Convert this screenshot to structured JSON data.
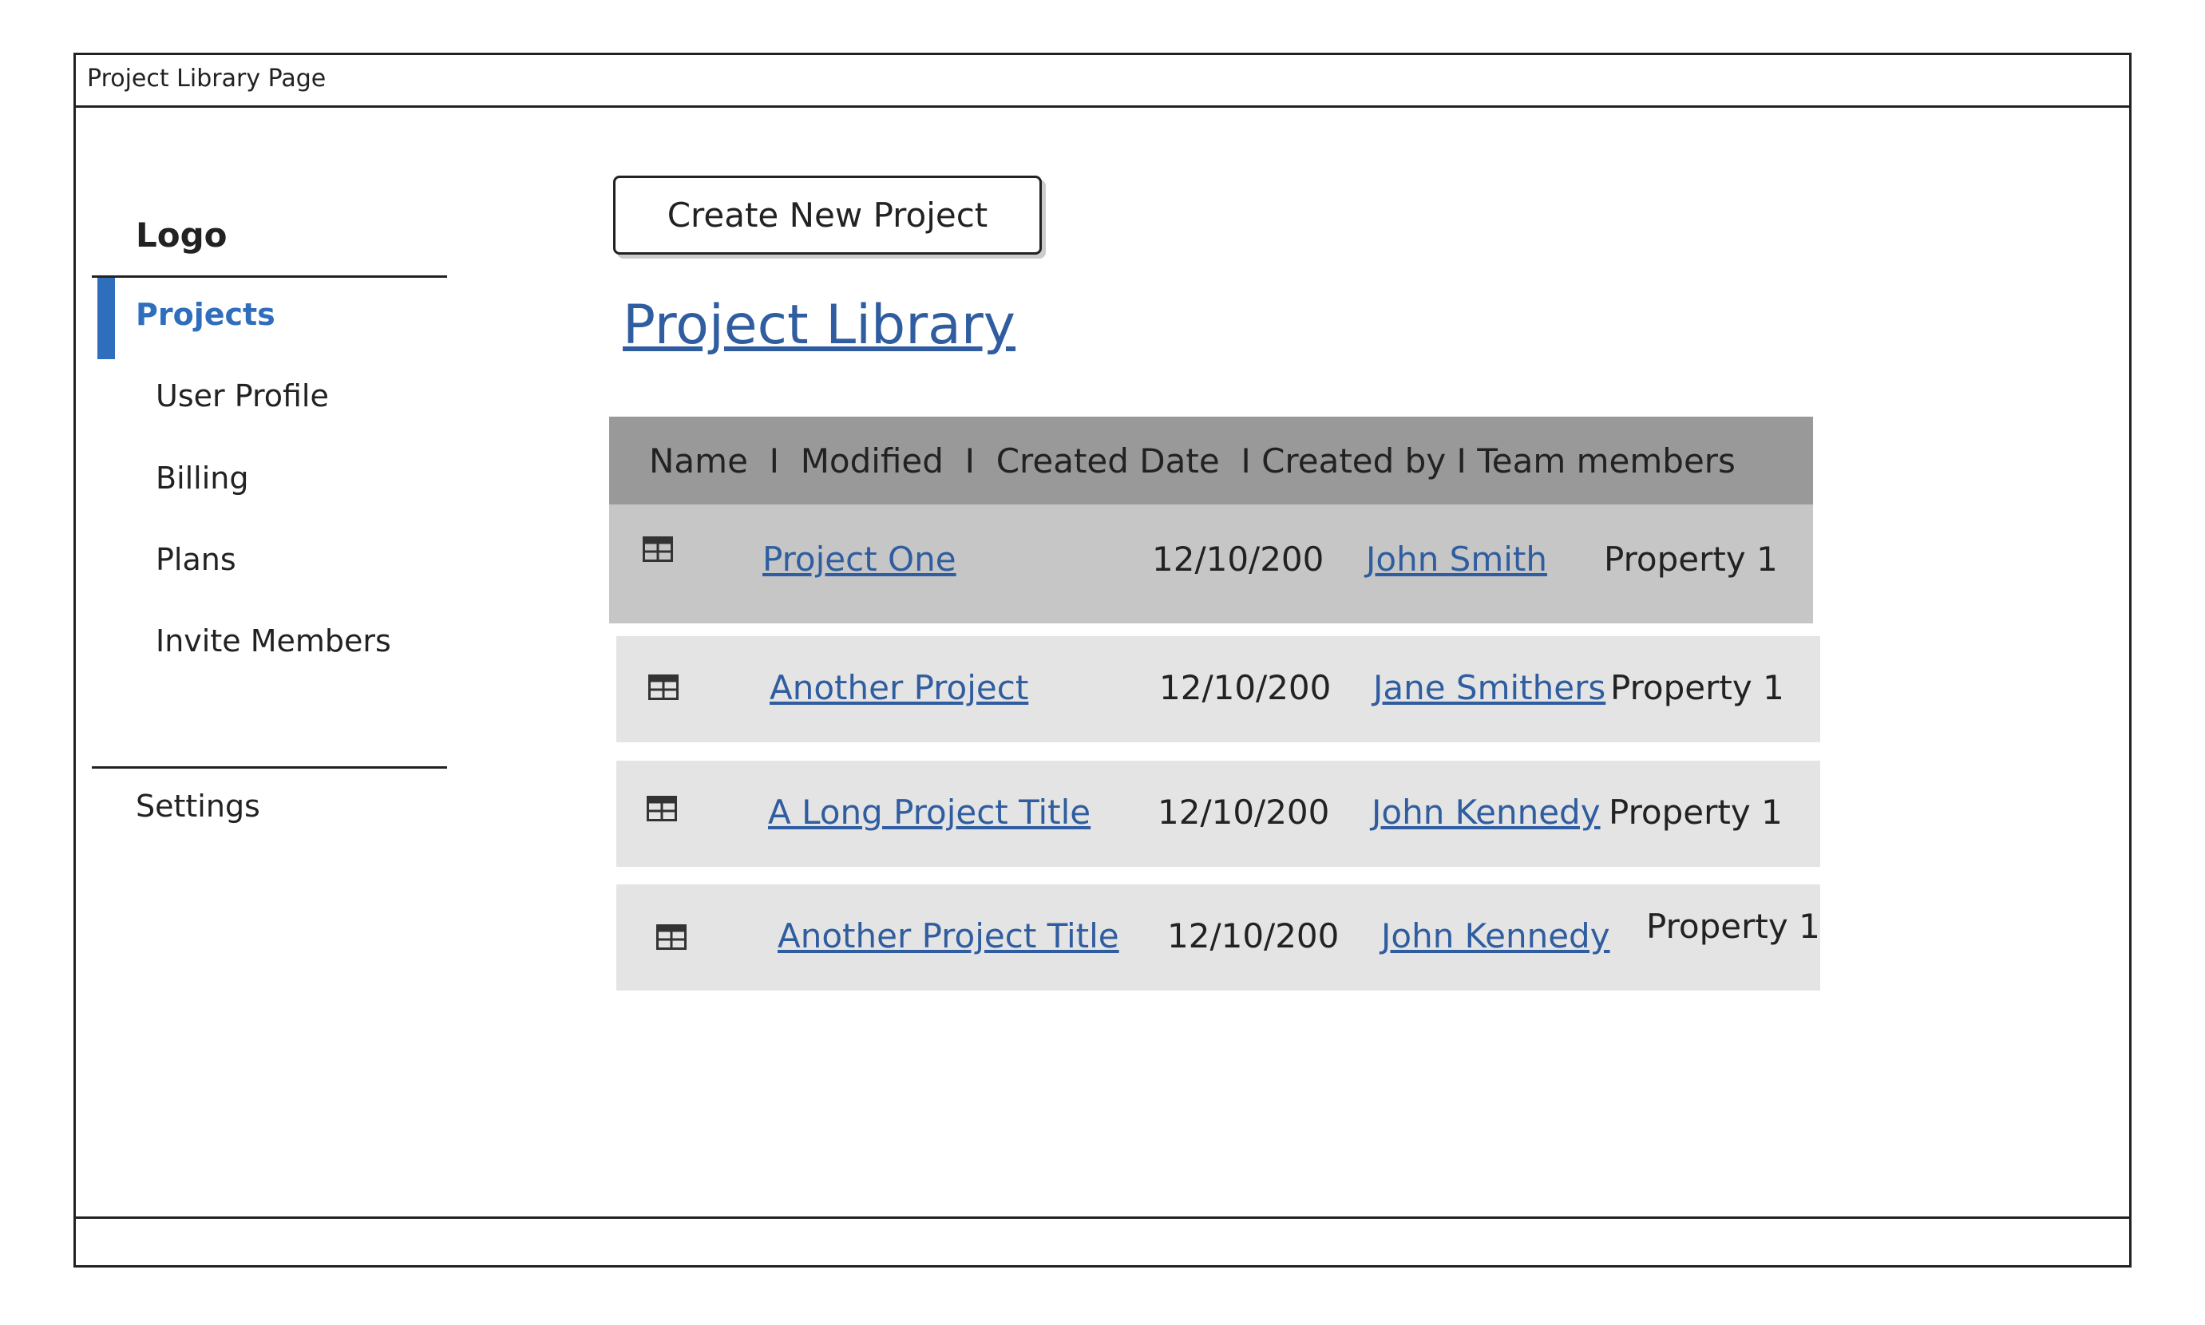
{
  "window": {
    "title": "Project Library Page"
  },
  "sidebar": {
    "logo": "Logo",
    "items": [
      {
        "label": "Projects",
        "active": true
      },
      {
        "label": "User Profile"
      },
      {
        "label": "Billing"
      },
      {
        "label": "Plans"
      },
      {
        "label": "Invite Members"
      }
    ],
    "settings_label": "Settings",
    "accent_color": "#2f6dbd"
  },
  "main": {
    "create_button_label": "Create New Project",
    "page_title": "Project Library",
    "table": {
      "header": "Name  I  Modified  I  Created Date  I Created by I Team members",
      "rows": [
        {
          "icon": "table-icon",
          "name": "Project One",
          "date": "12/10/200",
          "created_by": "John Smith",
          "team_members": "Property 1"
        },
        {
          "icon": "table-icon",
          "name": "Another Project",
          "date": "12/10/200",
          "created_by": "Jane Smithers",
          "team_members": "Property 1"
        },
        {
          "icon": "table-icon",
          "name": "A Long Project Title",
          "date": "12/10/200",
          "created_by": "John Kennedy",
          "team_members": "Property 1"
        },
        {
          "icon": "table-icon",
          "name": "Another Project Title",
          "date": "12/10/200",
          "created_by": "John Kennedy",
          "team_members": "Property 1"
        }
      ]
    }
  },
  "colors": {
    "link": "#2f5d9f",
    "header_bg": "#999999",
    "selected_row_bg": "#c6c6c6",
    "row_bg": "#e4e4e4"
  }
}
